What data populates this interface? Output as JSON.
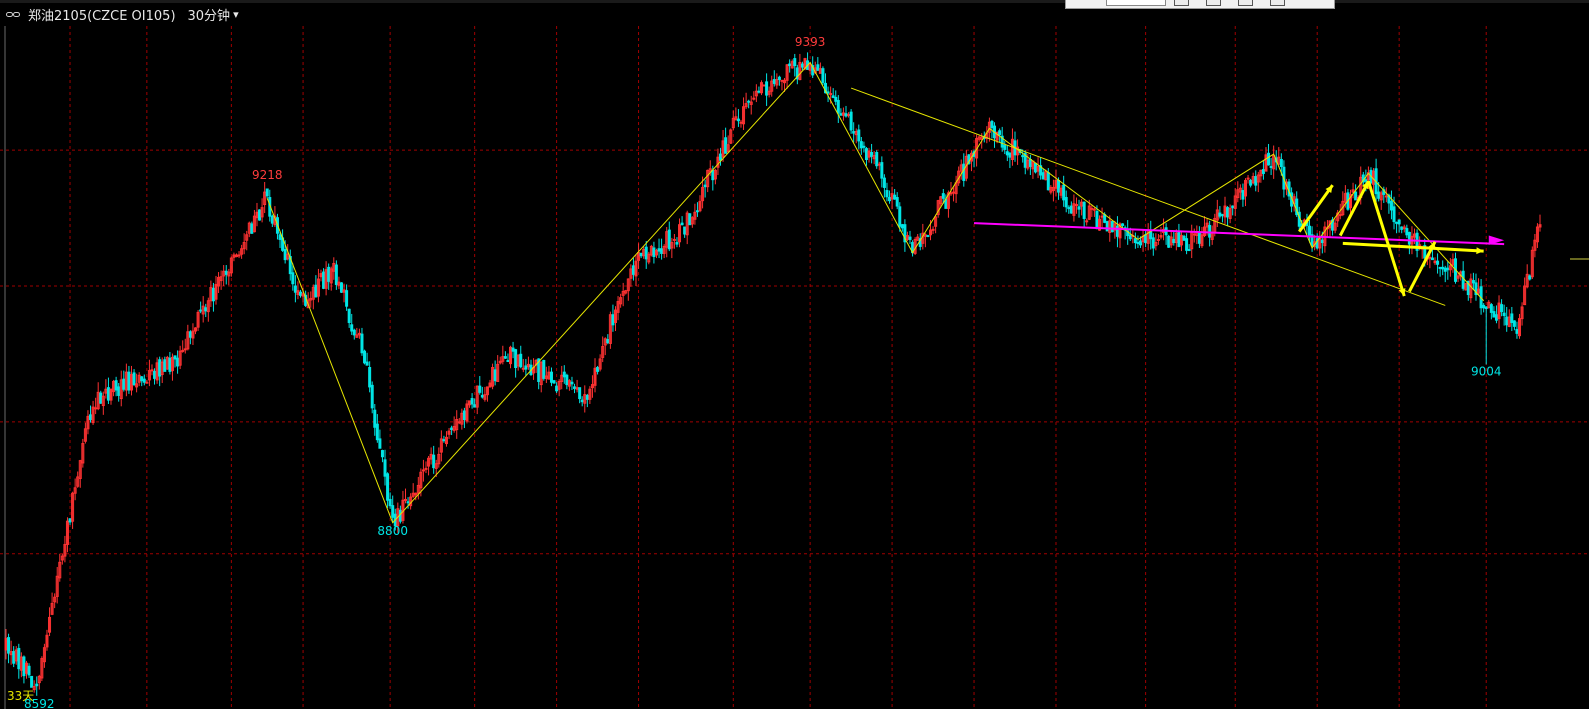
{
  "title_bar": {
    "symbol": "郑油2105(CZCE OI105)",
    "period": "30分钟",
    "chevron_icon": "chevron-down-icon",
    "link_icon": "link-icon"
  },
  "colors": {
    "background": "#000000",
    "up_candle": "#ff3232",
    "down_candle": "#00e5e5",
    "pattern_line": "#e6e600",
    "arrow": "#ffff00",
    "magenta_line": "#ff00ff",
    "grid": "#a00000",
    "high_label": "#ff3c3c",
    "low_label": "#00e5e5"
  },
  "chart_data": {
    "type": "candlestick",
    "title": "",
    "xlabel": "",
    "ylabel": "",
    "grid": true,
    "ylim": [
      8560,
      9440
    ],
    "series": [
      {
        "x": [
          0,
          1,
          2,
          3,
          4,
          5,
          6,
          7,
          8,
          9,
          10,
          11,
          12,
          13,
          14,
          15,
          16,
          17,
          18,
          19,
          20,
          21,
          22,
          23,
          24,
          25,
          26,
          27,
          28,
          29,
          30,
          31,
          32,
          33,
          34,
          35,
          36,
          37,
          38,
          39,
          40,
          41,
          42,
          43,
          44,
          45,
          46,
          47,
          48,
          49,
          50,
          51,
          52,
          53,
          54,
          55,
          56,
          57,
          58,
          59,
          60,
          61,
          62,
          63,
          64,
          65,
          66,
          67,
          68,
          69,
          70,
          71,
          72,
          73,
          74,
          75,
          76,
          77,
          78,
          79,
          80,
          81,
          82,
          83,
          84,
          85,
          86,
          87,
          88,
          89,
          90,
          91,
          92,
          93,
          94,
          95,
          96,
          97,
          98,
          99,
          100,
          101,
          102,
          103,
          104,
          105,
          106,
          107,
          108,
          109,
          110,
          111,
          112,
          113,
          114,
          115,
          116,
          117,
          118,
          119,
          120,
          121,
          122,
          123,
          124,
          125,
          126,
          127,
          128,
          129,
          130,
          131,
          132,
          133,
          134,
          135,
          136,
          137,
          138,
          139,
          140,
          141,
          142,
          143,
          144,
          145,
          146,
          147,
          148,
          149,
          150,
          151,
          152,
          153,
          154,
          155,
          156,
          157,
          158,
          159,
          160,
          161,
          162,
          163,
          164,
          165,
          166,
          167,
          168,
          169,
          170,
          171,
          172,
          173,
          174,
          175,
          176,
          177,
          178,
          179,
          180,
          181,
          182,
          183,
          184,
          185,
          186,
          187,
          188,
          189,
          190,
          191,
          192,
          193,
          194,
          195,
          196,
          197,
          198,
          199,
          200,
          201,
          202,
          203,
          204,
          205,
          206,
          207,
          208,
          209,
          210,
          211,
          212,
          213,
          214,
          215,
          216,
          217,
          218,
          219,
          220,
          221,
          222,
          223,
          224,
          225,
          226,
          227,
          228,
          229,
          230,
          231,
          232,
          233,
          234,
          235,
          236,
          237,
          238,
          239,
          240,
          241,
          242,
          243,
          244,
          245,
          246,
          247,
          248,
          249,
          250,
          251,
          252,
          253,
          254,
          255,
          256,
          257,
          258,
          259,
          260,
          261,
          262,
          263,
          264,
          265,
          266,
          267,
          268,
          269,
          270,
          271,
          272,
          273,
          274,
          275,
          276,
          277,
          278,
          279,
          280,
          281,
          282,
          283,
          284,
          285,
          286,
          287,
          288,
          289,
          290,
          291,
          292,
          293,
          294,
          295,
          296,
          297,
          298,
          299,
          300,
          301,
          302,
          303,
          304,
          305,
          306,
          307,
          308,
          309,
          310,
          311,
          312,
          313,
          314,
          315,
          316,
          317,
          318,
          319,
          320,
          321,
          322,
          323,
          324,
          325,
          326,
          327,
          328,
          329,
          330,
          331,
          332,
          333,
          334,
          335,
          336,
          337,
          338,
          339,
          340,
          341,
          342,
          343,
          344,
          345,
          346,
          347,
          348,
          349,
          350,
          351,
          352,
          353,
          354,
          355,
          356,
          357,
          358,
          359,
          360,
          361,
          362,
          363,
          364,
          365,
          366,
          367,
          368,
          369,
          370,
          371,
          372,
          373,
          374,
          375,
          376,
          377,
          378,
          379,
          380,
          381,
          382,
          383,
          384,
          385,
          386,
          387,
          388,
          389,
          390,
          391,
          392,
          393,
          394,
          395,
          396,
          397,
          398,
          399,
          400,
          401,
          402,
          403,
          404,
          405,
          406,
          407,
          408,
          409,
          410,
          411,
          412,
          413,
          414,
          415,
          416,
          417,
          418,
          419,
          420,
          421,
          422,
          423,
          424,
          425,
          426,
          427,
          428,
          429,
          430,
          431,
          432,
          433,
          434,
          435,
          436,
          437,
          438,
          439,
          440,
          441,
          442,
          443,
          444,
          445,
          446,
          447,
          448,
          449,
          450,
          451,
          452,
          453,
          454,
          455,
          456,
          457,
          458,
          459,
          460,
          461,
          462,
          463,
          464,
          465,
          466,
          467,
          468,
          469,
          470,
          471,
          472,
          473,
          474,
          475,
          476,
          477,
          478,
          479,
          480,
          481,
          482,
          483,
          484,
          485,
          486,
          487,
          488,
          489,
          490,
          491,
          492,
          493,
          494,
          495,
          496,
          497,
          498,
          499,
          500,
          501,
          502,
          503,
          504,
          505,
          506,
          507,
          508,
          509,
          510,
          511,
          512,
          513,
          514,
          515,
          516,
          517,
          518,
          519,
          520,
          521,
          522,
          523,
          524,
          525,
          526,
          527,
          528,
          529,
          530,
          531,
          532,
          533,
          534,
          535,
          536,
          537,
          538,
          539,
          540,
          541,
          542,
          543,
          544,
          545,
          546,
          547,
          548,
          549,
          550,
          551,
          552,
          553,
          554,
          555,
          556,
          557,
          558,
          559,
          560,
          561,
          562,
          563,
          564,
          565,
          566,
          567,
          568,
          569,
          570,
          571,
          572,
          573,
          574,
          575,
          576,
          577,
          578,
          579,
          580,
          581,
          582,
          583,
          584,
          585,
          586,
          587,
          588,
          589,
          590,
          591,
          592,
          593,
          594,
          595,
          596,
          597,
          598,
          599
        ],
        "open": [],
        "high": [],
        "low": [],
        "close": []
      }
    ],
    "anchor_prices": [
      {
        "x": 10,
        "price": 8592,
        "label": "8592",
        "kind": "low"
      },
      {
        "x": 102,
        "price": 9218,
        "label": "9218",
        "kind": "high"
      },
      {
        "x": 151,
        "price": 8800,
        "label": "8800",
        "kind": "low"
      },
      {
        "x": 314,
        "price": 9393,
        "label": "9393",
        "kind": "high"
      },
      {
        "x": 578,
        "price": 9004,
        "label": "9004",
        "kind": "low"
      }
    ],
    "zigzag_path": [
      {
        "x": 102,
        "y": 9218
      },
      {
        "x": 151,
        "y": 8800
      },
      {
        "x": 314,
        "y": 9393
      },
      {
        "x": 354,
        "y": 9148
      },
      {
        "x": 384,
        "y": 9308
      },
      {
        "x": 442,
        "y": 9165
      },
      {
        "x": 495,
        "y": 9275
      },
      {
        "x": 510,
        "y": 9154
      },
      {
        "x": 532,
        "y": 9250
      },
      {
        "x": 577,
        "y": 9086
      }
    ],
    "labels": {
      "corner_left_1": "33天",
      "corner_left_2": "8592",
      "high_9218": "9218",
      "low_8800": "8800",
      "high_9393": "9393",
      "low_9004": "9004"
    },
    "grid_price_levels": [
      9280,
      9105,
      8930,
      8760
    ],
    "grid_index_levels": [
      25,
      55,
      88,
      116,
      150,
      183,
      215,
      247,
      284,
      314,
      346,
      378,
      410,
      445,
      480,
      512,
      544,
      578
    ]
  }
}
